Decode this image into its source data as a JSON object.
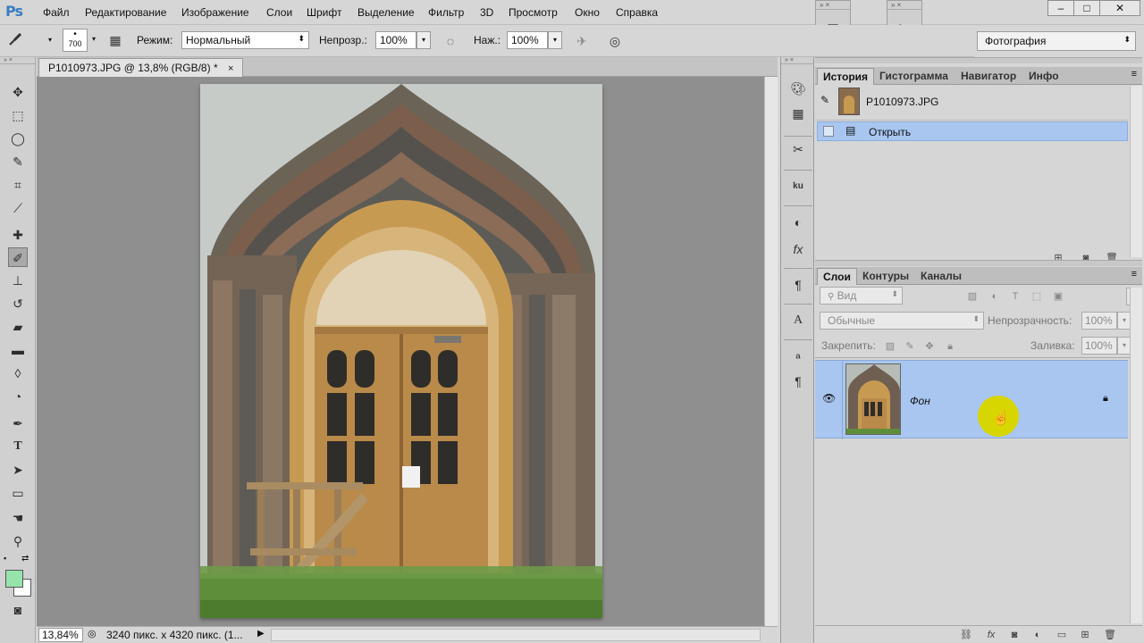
{
  "app": {
    "logo": "Ps"
  },
  "menu": [
    "Файл",
    "Редактирование",
    "Изображение",
    "Слои",
    "Шрифт",
    "Выделение",
    "Фильтр",
    "3D",
    "Просмотр",
    "Окно",
    "Справка"
  ],
  "workspace": {
    "value": "Фотография"
  },
  "options": {
    "brush_size": "700",
    "mode_label": "Режим:",
    "mode_value": "Нормальный",
    "opacity_label": "Непрозр.:",
    "opacity_value": "100%",
    "pressure_label": "Наж.:",
    "pressure_value": "100%"
  },
  "document": {
    "tab_title": "P1010973.JPG @ 13,8% (RGB/8) *",
    "close": "×",
    "zoom": "13,84%",
    "info": "3240 пикс. x 4320 пикс. (1..."
  },
  "history_panel": {
    "tabs": [
      "История",
      "Гистограмма",
      "Навигатор",
      "Инфо"
    ],
    "snapshot_name": "P1010973.JPG",
    "steps": [
      "Открыть"
    ]
  },
  "layers_panel": {
    "tabs": [
      "Слои",
      "Контуры",
      "Каналы"
    ],
    "filter_placeholder": "Вид",
    "blend_mode": "Обычные",
    "opacity_label": "Непрозрачность:",
    "opacity_value": "100%",
    "lock_label": "Закрепить:",
    "fill_label": "Заливка:",
    "fill_value": "100%",
    "layers": [
      {
        "name": "Фон",
        "locked": true,
        "visible": true
      }
    ]
  },
  "colors": {
    "foreground": "#96e3ac",
    "background": "#ffffff",
    "selection": "#a8c6f0",
    "cursor_highlight": "#d7d600"
  }
}
